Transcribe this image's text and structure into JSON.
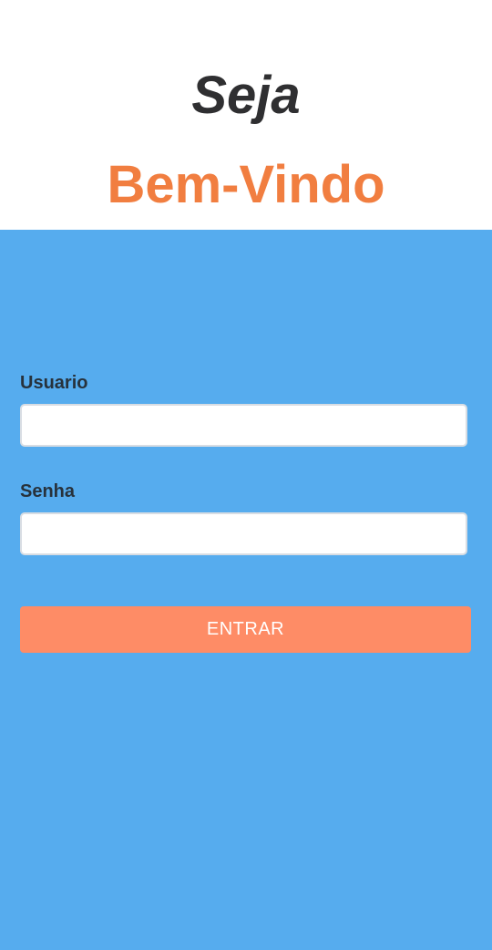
{
  "header": {
    "greeting": "Seja",
    "welcome": "Bem-Vindo"
  },
  "form": {
    "username_label": "Usuario",
    "username_value": "",
    "password_label": "Senha",
    "password_value": "",
    "submit_label": "ENTRAR"
  },
  "colors": {
    "header_background": "#ffffff",
    "greeting_text": "#2f2f31",
    "welcome_text": "#f17e40",
    "panel_background": "#56acee",
    "label_text": "#27323c",
    "button_background": "#fe8c66",
    "button_text": "#ffffff"
  }
}
